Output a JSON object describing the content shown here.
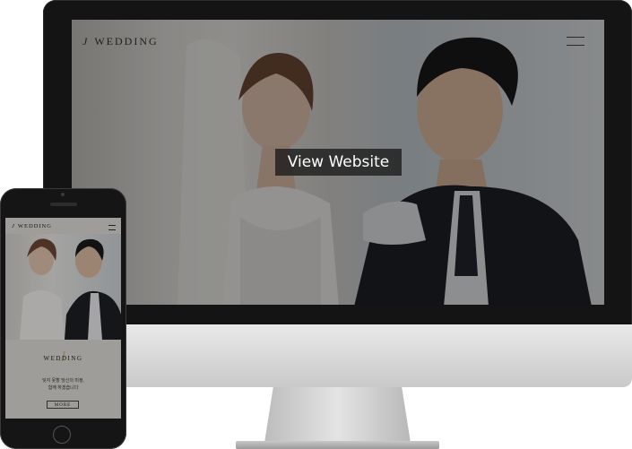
{
  "desktop_site": {
    "logo_mark": "J",
    "logo_text": "WEDDING",
    "view_button_label": "View Website"
  },
  "mobile_site": {
    "logo_mark": "J",
    "logo_text": "WEDDING",
    "section_title": "WEDDING",
    "section_mark": "J",
    "tagline_line1": "잊지 못할 당신의 미정,",
    "tagline_line2": "함께 하겠습니다",
    "more_button_label": "MORE"
  }
}
